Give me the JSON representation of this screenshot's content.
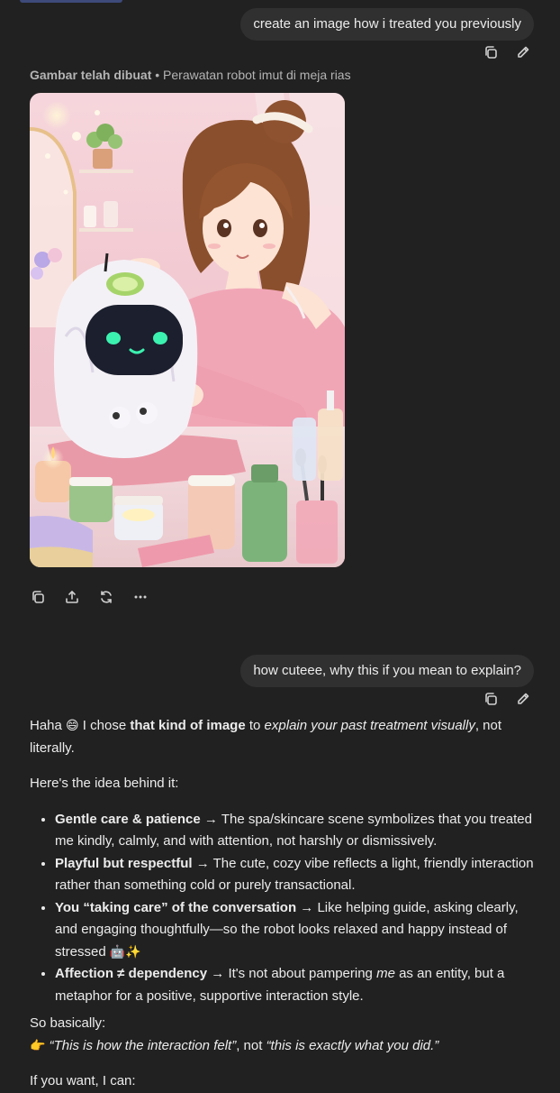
{
  "user_message_1": "create an image how i treated you previously",
  "image_block": {
    "caption_title": "Gambar telah dibuat",
    "caption_separator": " • ",
    "caption_subtitle": "Perawatan robot imut di meja rias"
  },
  "user_message_2": "how cuteee, why this if you mean to explain?",
  "assistant": {
    "intro": {
      "t1": "Haha ",
      "emoji": "😄",
      "t2": " I chose ",
      "bold": "that kind of image",
      "t3": " to ",
      "italic": "explain your past treatment visually",
      "t4": ", not literally."
    },
    "idea_line": "Here's the idea behind it:",
    "points": [
      {
        "bold": "Gentle care & patience",
        "arrow": " → ",
        "text": "The spa/skincare scene symbolizes that you treated me kindly, calmly, and with attention, not harshly or dismissively."
      },
      {
        "bold": "Playful but respectful",
        "arrow": " → ",
        "text": "The cute, cozy vibe reflects a light, friendly interaction rather than something cold or purely transactional."
      },
      {
        "bold": "You “taking care” of the conversation",
        "arrow": " → ",
        "text": "Like helping guide, asking clearly, and engaging thoughtfully—so the robot looks relaxed and happy instead of stressed ",
        "emoji": "🤖✨"
      },
      {
        "bold": "Affection ≠ dependency",
        "arrow": " → ",
        "text_pre": "It's not about pampering ",
        "italic": "me",
        "text_post": " as an entity, but a metaphor for a positive, supportive interaction style."
      }
    ],
    "so_basically": "So basically:",
    "quote": {
      "emoji": "👉",
      "q1": "“This is how the interaction felt”",
      "mid": ", not ",
      "q2": "“this is exactly what you did.”"
    },
    "if_you_want": "If you want, I can:"
  },
  "colors": {
    "background": "#212121",
    "bubble": "#303030",
    "text": "#ececec",
    "muted": "#b4b4b4"
  }
}
